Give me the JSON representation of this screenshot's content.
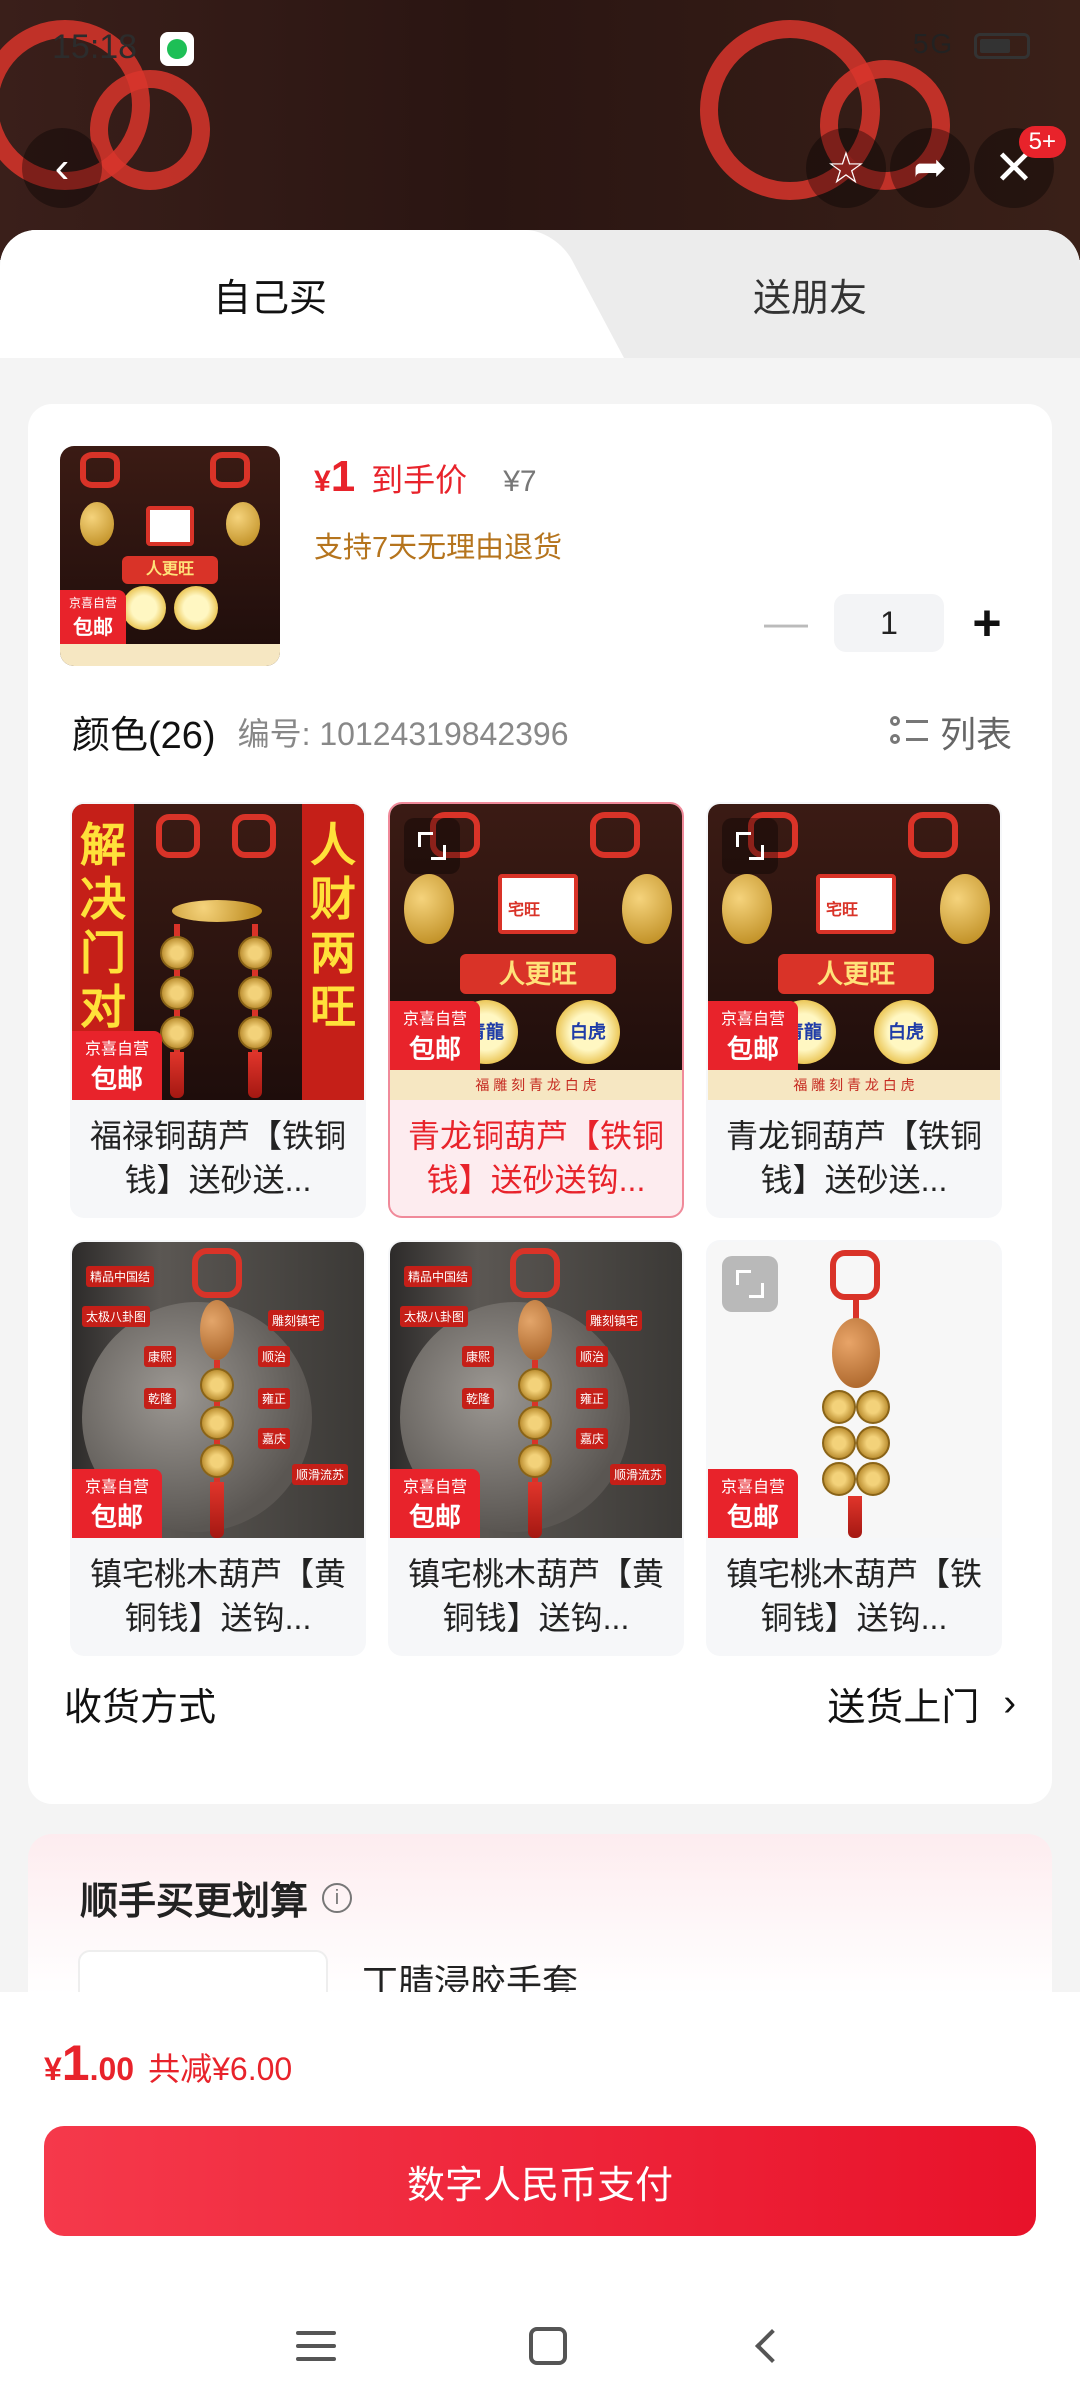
{
  "status_bar": {
    "time": "15:18",
    "right": "5G"
  },
  "header": {
    "badge": "5+"
  },
  "tabs": [
    {
      "label": "自己买"
    },
    {
      "label": "送朋友"
    }
  ],
  "product": {
    "price_symbol": "¥",
    "price": "1",
    "price_label": "到手价",
    "original_price": "¥7",
    "return_policy": "支持7天无理由退货",
    "quantity": "1"
  },
  "color_section": {
    "title": "颜色(26)",
    "sku": "编号: 10124319842396",
    "view_toggle": "列表"
  },
  "badge_text": {
    "line1": "京喜自营",
    "line2": "包邮"
  },
  "variants": [
    {
      "name": "福禄铜葫芦【铁铜钱】送砂送...",
      "banner_left": "解决门对",
      "banner_right": "人财两旺"
    },
    {
      "name": "青龙铜葫芦【铁铜钱】送砂送钩...",
      "house": "宅旺",
      "pill": "人更旺",
      "medal_left": "青龍",
      "medal_right": "白虎",
      "strip": "福 雕 刻 青 龙 白 虎"
    },
    {
      "name": "青龙铜葫芦【铁铜钱】送砂送...",
      "house": "宅旺",
      "pill": "人更旺",
      "medal_left": "青龍",
      "medal_right": "白虎",
      "strip": "福 雕 刻 青 龙 白 虎"
    },
    {
      "name": "镇宅桃木葫芦【黄铜钱】送钩...",
      "tags": [
        "精品中国结",
        "太极八卦图",
        "雕刻镇宅",
        "康熙",
        "顺治",
        "乾隆",
        "雍正",
        "嘉庆",
        "顺滑流苏"
      ]
    },
    {
      "name": "镇宅桃木葫芦【黄铜钱】送钩...",
      "tags": [
        "精品中国结",
        "太极八卦图",
        "雕刻镇宅",
        "康熙",
        "顺治",
        "乾隆",
        "雍正",
        "嘉庆",
        "顺滑流苏"
      ]
    },
    {
      "name": "镇宅桃木葫芦【铁铜钱】送钩..."
    }
  ],
  "delivery": {
    "label": "收货方式",
    "value": "送货上门"
  },
  "addon": {
    "title": "顺手买更划算",
    "item_name": "丁腈浸胶手套"
  },
  "footer": {
    "total_symbol": "¥",
    "total_int": "1",
    "total_dec": ".00",
    "savings": "共减¥6.00",
    "pay_button": "数字人民币支付"
  },
  "colors": {
    "accent": "#e8232b",
    "gold_text": "#b5741d"
  }
}
